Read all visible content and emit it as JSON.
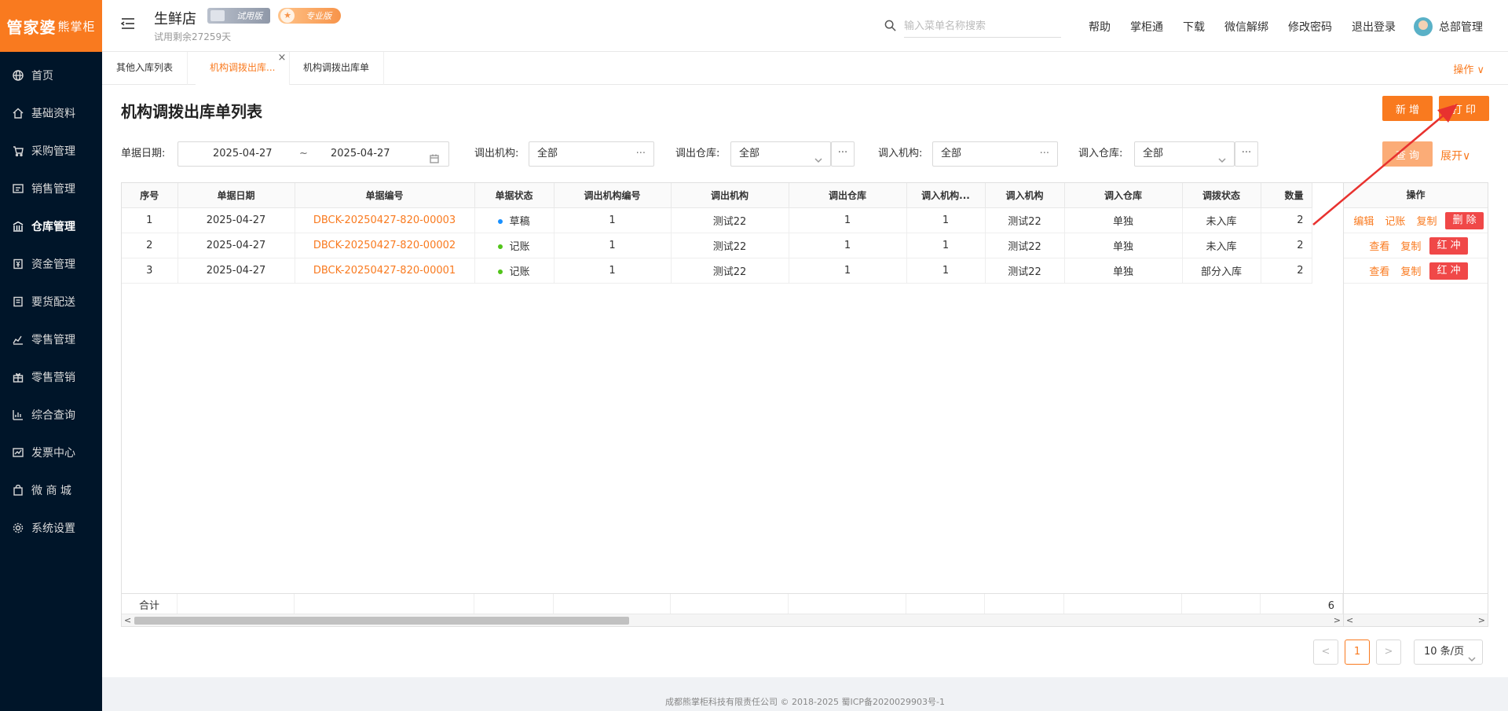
{
  "logo": {
    "main": "管家婆",
    "sub": "熊掌柜"
  },
  "sidebar": {
    "items": [
      {
        "label": "首页",
        "icon": "globe-icon"
      },
      {
        "label": "基础资料",
        "icon": "home-icon"
      },
      {
        "label": "采购管理",
        "icon": "cart-icon"
      },
      {
        "label": "销售管理",
        "icon": "sales-icon"
      },
      {
        "label": "仓库管理",
        "icon": "warehouse-icon"
      },
      {
        "label": "资金管理",
        "icon": "money-icon"
      },
      {
        "label": "要货配送",
        "icon": "delivery-icon"
      },
      {
        "label": "零售管理",
        "icon": "chart-icon"
      },
      {
        "label": "零售营销",
        "icon": "gift-icon"
      },
      {
        "label": "综合查询",
        "icon": "bar-chart-icon"
      },
      {
        "label": "发票中心",
        "icon": "invoice-icon"
      },
      {
        "label": "微 商 城",
        "icon": "bag-icon"
      },
      {
        "label": "系统设置",
        "icon": "gear-icon"
      }
    ],
    "active_index": 4
  },
  "header": {
    "shop_name": "生鲜店",
    "trial_badge": "试用版",
    "pro_badge": "专业版",
    "trial_days": "试用剩余27259天",
    "search_placeholder": "输入菜单名称搜索",
    "links": [
      "帮助",
      "掌柜通",
      "下载",
      "微信解绑",
      "修改密码",
      "退出登录"
    ],
    "user_name": "总部管理"
  },
  "tabs": {
    "items": [
      "其他入库列表",
      "机构调拨出库...",
      "机构调拨出库单"
    ],
    "active_index": 1,
    "close_glyph": "×",
    "ops_label": "操作 ∨"
  },
  "page": {
    "title": "机构调拨出库单列表",
    "btn_new": "新 增",
    "btn_print": "打 印",
    "btn_query": "查 询",
    "expand_label": "展开∨"
  },
  "filters": {
    "date_label": "单据日期:",
    "date_start": "2025-04-27",
    "date_sep": "~",
    "date_end": "2025-04-27",
    "out_org_label": "调出机构:",
    "out_org_value": "全部",
    "out_wh_label": "调出仓库:",
    "out_wh_value": "全部",
    "in_org_label": "调入机构:",
    "in_org_value": "全部",
    "in_wh_label": "调入仓库:",
    "in_wh_value": "全部",
    "more": "···"
  },
  "table": {
    "columns": [
      "序号",
      "单据日期",
      "单据编号",
      "单据状态",
      "调出机构编号",
      "调出机构",
      "调出仓库",
      "调入机构...",
      "调入机构",
      "调入仓库",
      "调拨状态",
      "数量"
    ],
    "ops_header": "操作",
    "rows": [
      {
        "seq": "1",
        "date": "2025-04-27",
        "no": "DBCK-20250427-820-00003",
        "status": "草稿",
        "status_color": "#1890ff",
        "out_org_no": "1",
        "out_org": "测试22",
        "out_wh": "1",
        "in_org_no": "1",
        "in_org": "测试22",
        "in_wh": "单独",
        "alloc_status": "未入库",
        "qty": "2",
        "ops": [
          "编辑",
          "记账",
          "复制"
        ],
        "op_btn": "删 除"
      },
      {
        "seq": "2",
        "date": "2025-04-27",
        "no": "DBCK-20250427-820-00002",
        "status": "记账",
        "status_color": "#52c41a",
        "out_org_no": "1",
        "out_org": "测试22",
        "out_wh": "1",
        "in_org_no": "1",
        "in_org": "测试22",
        "in_wh": "单独",
        "alloc_status": "未入库",
        "qty": "2",
        "ops": [
          "查看",
          "复制"
        ],
        "op_btn": "红 冲"
      },
      {
        "seq": "3",
        "date": "2025-04-27",
        "no": "DBCK-20250427-820-00001",
        "status": "记账",
        "status_color": "#52c41a",
        "out_org_no": "1",
        "out_org": "测试22",
        "out_wh": "1",
        "in_org_no": "1",
        "in_org": "测试22",
        "in_wh": "单独",
        "alloc_status": "部分入库",
        "qty": "2",
        "ops": [
          "查看",
          "复制"
        ],
        "op_btn": "红 冲"
      }
    ],
    "summary_label": "合计",
    "summary_qty": "6"
  },
  "pagination": {
    "prev": "<",
    "current": "1",
    "next": ">",
    "page_size": "10 条/页"
  },
  "footer": "成都熊掌柜科技有限责任公司 © 2018-2025 蜀ICP备2020029903号-1",
  "colors": {
    "accent": "#f97a1f",
    "danger": "#f04848",
    "sidebar_bg": "#001529",
    "annotation": "#e8322f"
  }
}
